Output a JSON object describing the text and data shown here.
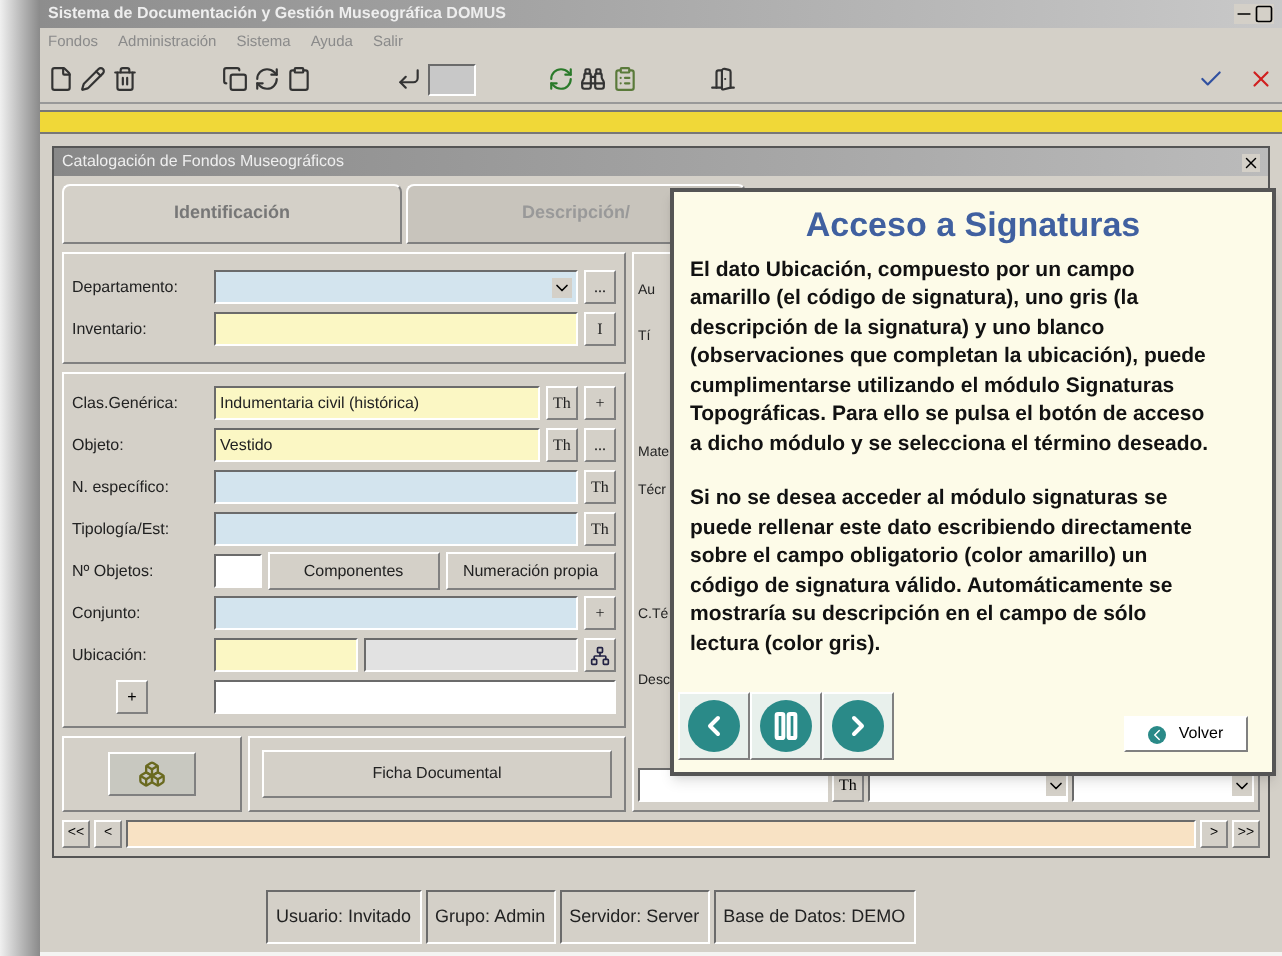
{
  "window": {
    "title": "Sistema de Documentación y Gestión Museográfica DOMUS"
  },
  "menu": [
    "Fondos",
    "Administración",
    "Sistema",
    "Ayuda",
    "Salir"
  ],
  "child_window": {
    "title": "Catalogación de Fondos Museográficos"
  },
  "tabs": [
    {
      "label": "Identificación",
      "selected": true
    },
    {
      "label": "Descripción/",
      "selected": false
    }
  ],
  "section_top": [
    {
      "kind": "field",
      "label": "Departamento:",
      "fields": [
        {
          "kind": "lookup",
          "dropdown": true
        }
      ],
      "buttons": [
        {
          "kind": "text",
          "label": "..."
        }
      ]
    },
    {
      "kind": "field",
      "label": "Inventario:",
      "fields": [
        {
          "kind": "required"
        }
      ],
      "buttons": [
        {
          "kind": "text",
          "label": "I"
        }
      ]
    }
  ],
  "section_main": [
    {
      "kind": "field",
      "label": "Clas.Genérica:",
      "fields": [
        {
          "kind": "required",
          "value": "Indumentaria civil (histórica)"
        }
      ],
      "buttons": [
        {
          "kind": "text",
          "label": "Th"
        },
        {
          "kind": "text",
          "label": "+"
        }
      ]
    },
    {
      "kind": "field",
      "label": "Objeto:",
      "fields": [
        {
          "kind": "required",
          "value": "Vestido"
        }
      ],
      "buttons": [
        {
          "kind": "text",
          "label": "Th"
        },
        {
          "kind": "text",
          "label": "..."
        }
      ]
    },
    {
      "kind": "field",
      "label": "N. específico:",
      "fields": [
        {
          "kind": "lookup"
        }
      ],
      "buttons": [
        {
          "kind": "text",
          "label": "Th"
        }
      ]
    },
    {
      "kind": "field",
      "label": "Tipología/Est:",
      "fields": [
        {
          "kind": "lookup"
        }
      ],
      "buttons": [
        {
          "kind": "text",
          "label": "Th"
        }
      ]
    },
    {
      "kind": "field",
      "label": "Nº Objetos:",
      "fields": [
        {
          "kind": "count"
        }
      ],
      "buttons": [
        {
          "kind": "wide",
          "label": "Componentes"
        },
        {
          "kind": "wide",
          "label": "Numeración propia"
        }
      ]
    },
    {
      "kind": "field",
      "label": "Conjunto:",
      "fields": [
        {
          "kind": "lookup"
        }
      ],
      "buttons": [
        {
          "kind": "text",
          "label": "+"
        }
      ]
    },
    {
      "kind": "field",
      "label": "Ubicación:",
      "fields": [
        {
          "kind": "required"
        },
        {
          "kind": "readonly"
        }
      ],
      "buttons": [
        {
          "kind": "tree"
        }
      ]
    },
    {
      "kind": "extra",
      "label": "+",
      "fields": [
        {
          "kind": "free"
        }
      ]
    }
  ],
  "document_button": "Ficha Documental",
  "right_labels": [
    "Au",
    "Tí",
    "Mate",
    "Técr",
    "C.Té",
    "Desc"
  ],
  "right_bottom": {
    "button": "Th"
  },
  "help": {
    "title": "Acceso a Signaturas",
    "paragraphs": [
      "El dato Ubicación, compuesto por un campo amarillo (el código de signatura), uno gris (la descripción de la signatura) y uno blanco (observaciones que completan la ubicación), puede cumplimentarse utilizando el módulo Signaturas Topográficas. Para ello se pulsa el botón de acceso a dicho módulo y se selecciona el término deseado.",
      "Si no se desea acceder al módulo signaturas se puede rellenar este dato escribiendo directamente sobre el campo obligatorio (color amarillo) un código de signatura válido. Automáticamente se mostraría su descripción en el campo de sólo lectura (color gris)."
    ],
    "back_button": "Volver"
  },
  "navigator": {
    "first": "<<",
    "prev": "<",
    "next": ">",
    "last": ">>"
  },
  "status_bar": [
    "Usuario: Invitado",
    "Grupo: Admin",
    "Servidor: Server",
    "Base de Datos: DEMO"
  ]
}
